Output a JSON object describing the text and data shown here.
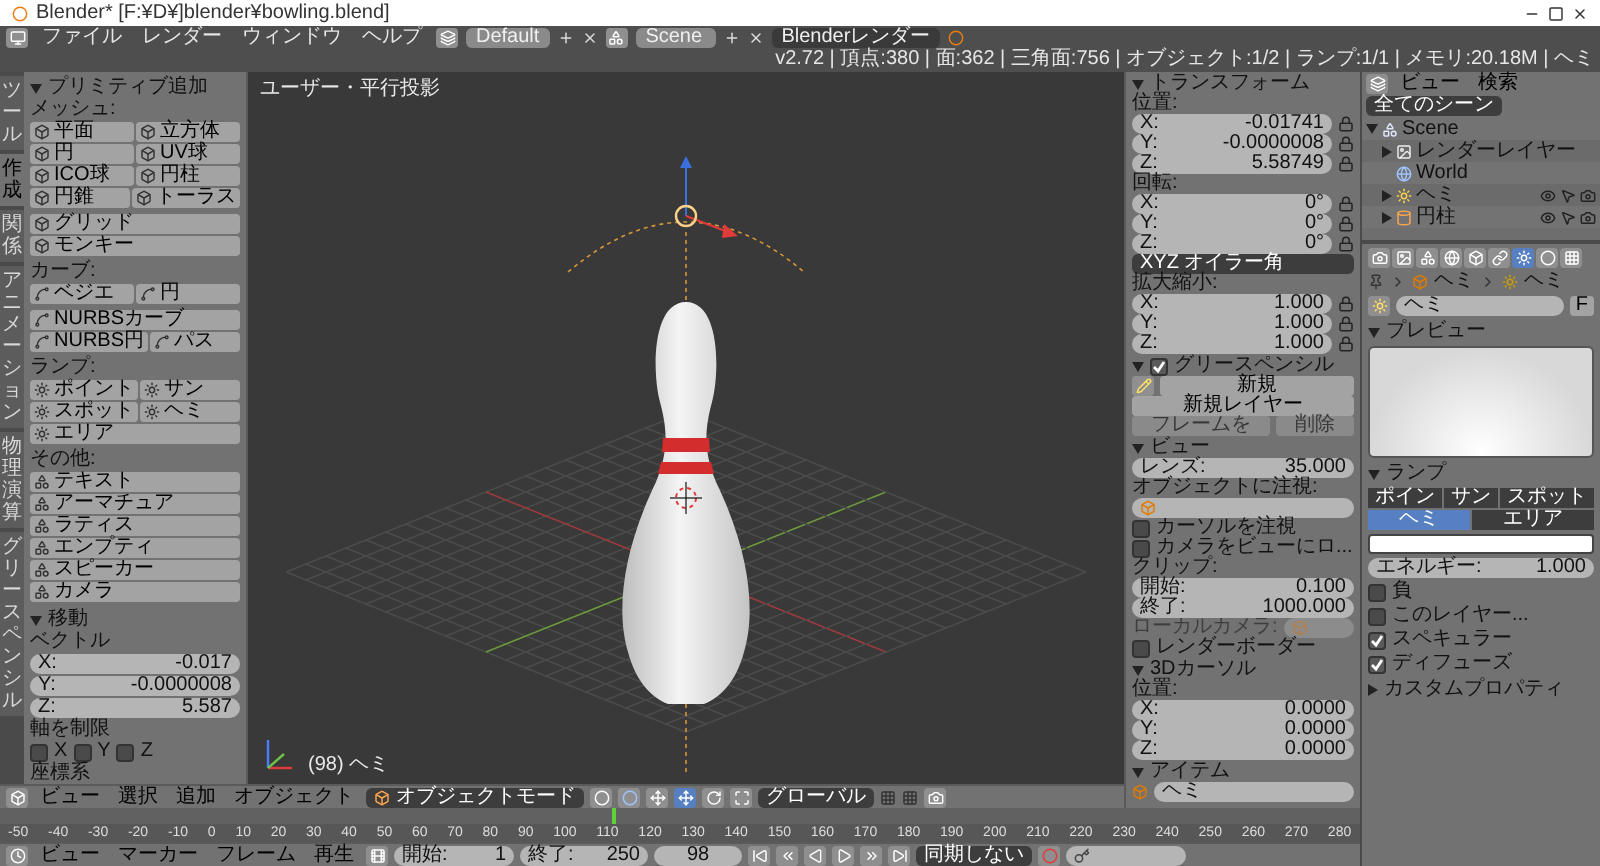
{
  "window": {
    "title": "Blender* [F:¥D¥]blender¥bowling.blend]"
  },
  "info_header": {
    "menus": [
      "ファイル",
      "レンダー",
      "ウィンドウ",
      "ヘルプ"
    ],
    "layout": "Default",
    "scene": "Scene",
    "engine": "Blenderレンダー",
    "stats": "v2.72 | 頂点:380 | 面:362 | 三角面:756 | オブジェクト:1/2 | ランプ:1/1 | メモリ:20.18M | ヘミ"
  },
  "shelf_tabs": [
    {
      "label": "ツール",
      "selected": false
    },
    {
      "label": "作成",
      "selected": true
    },
    {
      "label": "関係",
      "selected": false
    },
    {
      "label": "アニメーション",
      "selected": false
    },
    {
      "label": "物理演算",
      "selected": false
    },
    {
      "label": "グリースペンシル",
      "selected": false
    }
  ],
  "tool_shelf": {
    "title": "プリミティブ追加",
    "sections": [
      {
        "label": "メッシュ:",
        "kind": "mesh",
        "groups": [
          [
            "平面",
            "立方体",
            "円",
            "UV球",
            "ICO球",
            "円柱",
            "円錐",
            "トーラス"
          ],
          [
            "グリッド",
            "モンキー"
          ]
        ]
      },
      {
        "label": "カーブ:",
        "kind": "curve",
        "groups": [
          [
            "ベジエ",
            "円"
          ],
          [
            "NURBSカーブ",
            "NURBS円",
            "パス"
          ]
        ]
      },
      {
        "label": "ランプ:",
        "kind": "lamp",
        "groups": [
          [
            "ポイント",
            "サン",
            "スポット",
            "ヘミ",
            "エリア"
          ]
        ]
      },
      {
        "label": "その他:",
        "kind": "other",
        "groups": [
          [
            "テキスト",
            "アーマチュア",
            "ラティス",
            "エンプティ",
            "スピーカー",
            "カメラ"
          ]
        ]
      }
    ]
  },
  "operator_panel": {
    "title": "移動",
    "vector_label": "ベクトル",
    "vector": [
      {
        "axis": "X:",
        "value": "-0.017"
      },
      {
        "axis": "Y:",
        "value": "-0.0000008"
      },
      {
        "axis": "Z:",
        "value": "5.587"
      }
    ],
    "constraint_label": "軸を制限",
    "constraints": [
      {
        "label": "X",
        "checked": false
      },
      {
        "label": "Y",
        "checked": false
      },
      {
        "label": "Z",
        "checked": false
      }
    ],
    "orientation_label": "座標系"
  },
  "viewport": {
    "view_label": "ユーザー・平行投影",
    "object_label": "(98) ヘミ"
  },
  "viewport_header": {
    "menus": [
      "ビュー",
      "選択",
      "追加",
      "オブジェクト"
    ],
    "mode": "オブジェクトモード",
    "orientation": "グローバル"
  },
  "n_panel": {
    "transform": {
      "title": "トランスフォーム",
      "location_label": "位置:",
      "location": [
        {
          "axis": "X:",
          "value": "-0.01741"
        },
        {
          "axis": "Y:",
          "value": "-0.0000008"
        },
        {
          "axis": "Z:",
          "value": "5.58749"
        }
      ],
      "rotation_label": "回転:",
      "rotation": [
        {
          "axis": "X:",
          "value": "0°"
        },
        {
          "axis": "Y:",
          "value": "0°"
        },
        {
          "axis": "Z:",
          "value": "0°"
        }
      ],
      "rotation_mode": "XYZ オイラー角",
      "scale_label": "拡大縮小:",
      "scale": [
        {
          "axis": "X:",
          "value": "1.000"
        },
        {
          "axis": "Y:",
          "value": "1.000"
        },
        {
          "axis": "Z:",
          "value": "1.000"
        }
      ]
    },
    "grease_pencil": {
      "title": "グリースペンシル",
      "enabled": true,
      "new_button": "新規",
      "new_layer_button": "新規レイヤー",
      "buttons": [
        {
          "label": "フレームを",
          "disabled": true
        },
        {
          "label": "削除",
          "disabled": true
        }
      ]
    },
    "view": {
      "title": "ビュー",
      "lens": {
        "label": "レンズ:",
        "value": "35.000"
      },
      "lock_label": "オブジェクトに注視:",
      "lock_cursor": {
        "label": "カーソルを注視",
        "checked": false
      },
      "lock_camera": {
        "label": "カメラをビューにロ...",
        "checked": false
      },
      "clip_label": "クリップ:",
      "clip_start": {
        "label": "開始:",
        "value": "0.100"
      },
      "clip_end": {
        "label": "終了:",
        "value": "1000.000"
      },
      "local_camera_label": "ローカルカメラ:",
      "render_border": {
        "label": "レンダーボーダー",
        "checked": false
      }
    },
    "cursor": {
      "title": "3Dカーソル",
      "location_label": "位置:",
      "location": [
        {
          "axis": "X:",
          "value": "0.0000"
        },
        {
          "axis": "Y:",
          "value": "0.0000"
        },
        {
          "axis": "Z:",
          "value": "0.0000"
        }
      ]
    },
    "item": {
      "title": "アイテム",
      "name": "ヘミ"
    }
  },
  "outliner": {
    "menus": [
      "ビュー",
      "検索"
    ],
    "filter": "全てのシーン",
    "tree": [
      {
        "label": "Scene",
        "kind": "scene",
        "expanded": true,
        "children": [
          {
            "label": "レンダーレイヤー",
            "kind": "render_layer",
            "expanded": false
          },
          {
            "label": "World",
            "kind": "world"
          },
          {
            "label": "ヘミ",
            "kind": "lamp",
            "expanded": false
          },
          {
            "label": "円柱",
            "kind": "mesh",
            "expanded": false
          }
        ]
      }
    ]
  },
  "properties": {
    "tabs": [
      {
        "selected": false
      },
      {
        "selected": false
      },
      {
        "selected": false
      },
      {
        "selected": false
      },
      {
        "selected": false
      },
      {
        "selected": false
      },
      {
        "selected": true
      },
      {
        "selected": false
      },
      {
        "selected": false
      }
    ],
    "breadcrumb": [
      "ヘミ",
      "ヘミ"
    ],
    "datablock": {
      "name": "ヘミ",
      "fake_user": "F"
    },
    "preview_title": "プレビュー",
    "lamp": {
      "title": "ランプ",
      "types": [
        {
          "label": "ポイン",
          "selected": false
        },
        {
          "label": "サン",
          "selected": false
        },
        {
          "label": "スポット",
          "selected": false
        },
        {
          "label": "ヘミ",
          "selected": true
        },
        {
          "label": "エリア",
          "selected": false
        }
      ],
      "energy": {
        "label": "エネルギー:",
        "value": "1.000"
      },
      "options": [
        {
          "label": "負",
          "checked": false
        },
        {
          "label": "このレイヤー...",
          "checked": false
        },
        {
          "label": "スペキュラー",
          "checked": true
        },
        {
          "label": "ディフューズ",
          "checked": true
        }
      ]
    },
    "custom_properties": {
      "title": "カスタムプロパティ",
      "expanded": false
    }
  },
  "timeline": {
    "ruler": [
      "-50",
      "-40",
      "-30",
      "-20",
      "-10",
      "0",
      "10",
      "20",
      "30",
      "40",
      "50",
      "60",
      "70",
      "80",
      "90",
      "100",
      "110",
      "120",
      "130",
      "140",
      "150",
      "160",
      "170",
      "180",
      "190",
      "200",
      "210",
      "220",
      "230",
      "240",
      "250",
      "260",
      "270",
      "280"
    ],
    "playhead": {
      "level": 0.45
    },
    "menus": [
      "ビュー",
      "マーカー",
      "フレーム",
      "再生"
    ],
    "start": {
      "label": "開始:",
      "value": "1"
    },
    "end": {
      "label": "終了:",
      "value": "250"
    },
    "frame": "98",
    "sync": "同期しない"
  }
}
